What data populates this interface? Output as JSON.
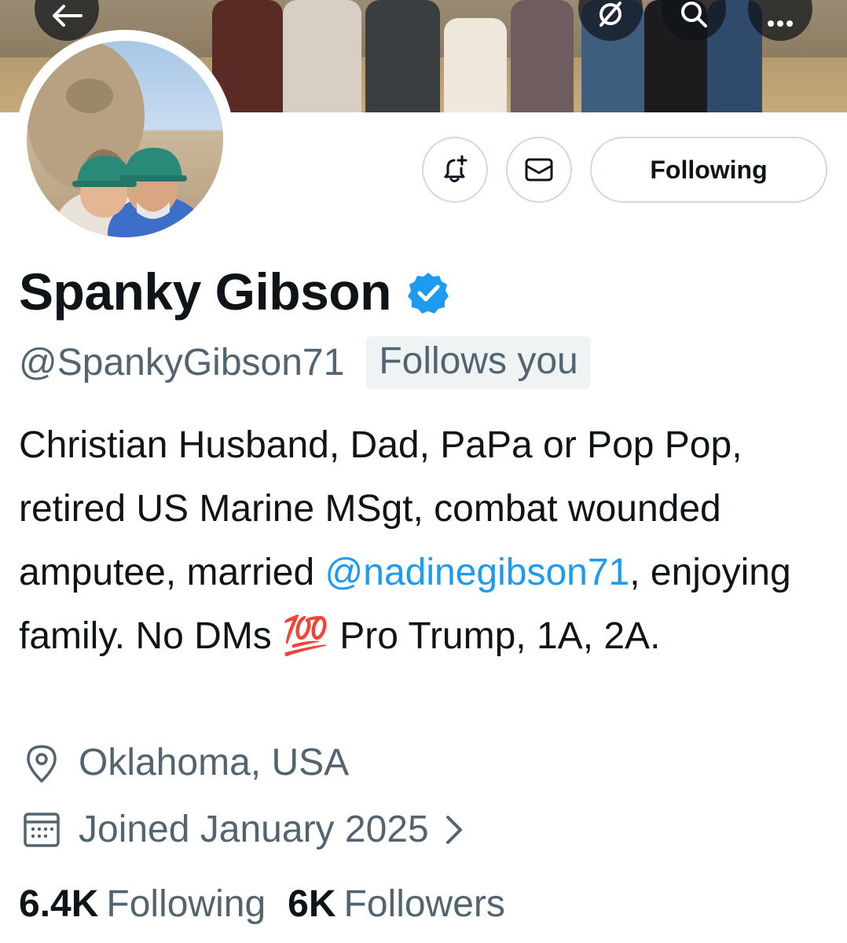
{
  "header": {
    "back_icon": "arrow-left-icon",
    "grok_icon": "grok-icon",
    "search_icon": "search-icon",
    "more_icon": "more-horizontal-icon"
  },
  "profile": {
    "display_name": "Spanky Gibson",
    "verified": true,
    "handle": "@SpankyGibson71",
    "follows_you_badge": "Follows you",
    "bio_part1": "Christian Husband, Dad, PaPa or Pop Pop, retired US Marine MSgt, combat wounded amputee, married ",
    "bio_mention": "@nadinegibson71",
    "bio_part2": ", enjoying family. No DMs ",
    "bio_emoji": "💯",
    "bio_part3": " Pro Trump, 1A, 2A.",
    "location": "Oklahoma, USA",
    "joined": "Joined January 2025",
    "following_count": "6.4K",
    "following_label": "Following",
    "followers_count": "6K",
    "followers_label": "Followers"
  },
  "actions": {
    "notify_icon": "bell-plus-icon",
    "message_icon": "envelope-icon",
    "follow_button_label": "Following"
  },
  "colors": {
    "accent": "#1d9bf0",
    "text": "#0f1419",
    "secondary": "#536471",
    "border": "#cfd9de"
  }
}
